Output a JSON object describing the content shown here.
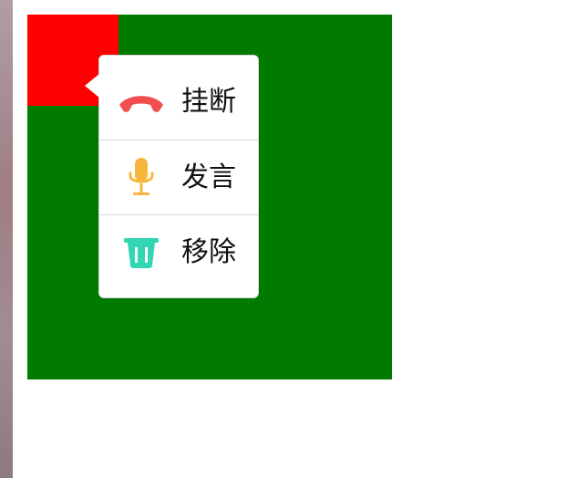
{
  "menu": {
    "items": [
      {
        "label": "挂断",
        "icon": "hang-up-icon",
        "color": "#f24e4e"
      },
      {
        "label": "发言",
        "icon": "microphone-icon",
        "color": "#f6b73c"
      },
      {
        "label": "移除",
        "icon": "trash-icon",
        "color": "#33d6b3"
      }
    ]
  },
  "colors": {
    "panel_bg": "#007b00",
    "corner_square": "#ff0000",
    "popup_bg": "#ffffff"
  }
}
